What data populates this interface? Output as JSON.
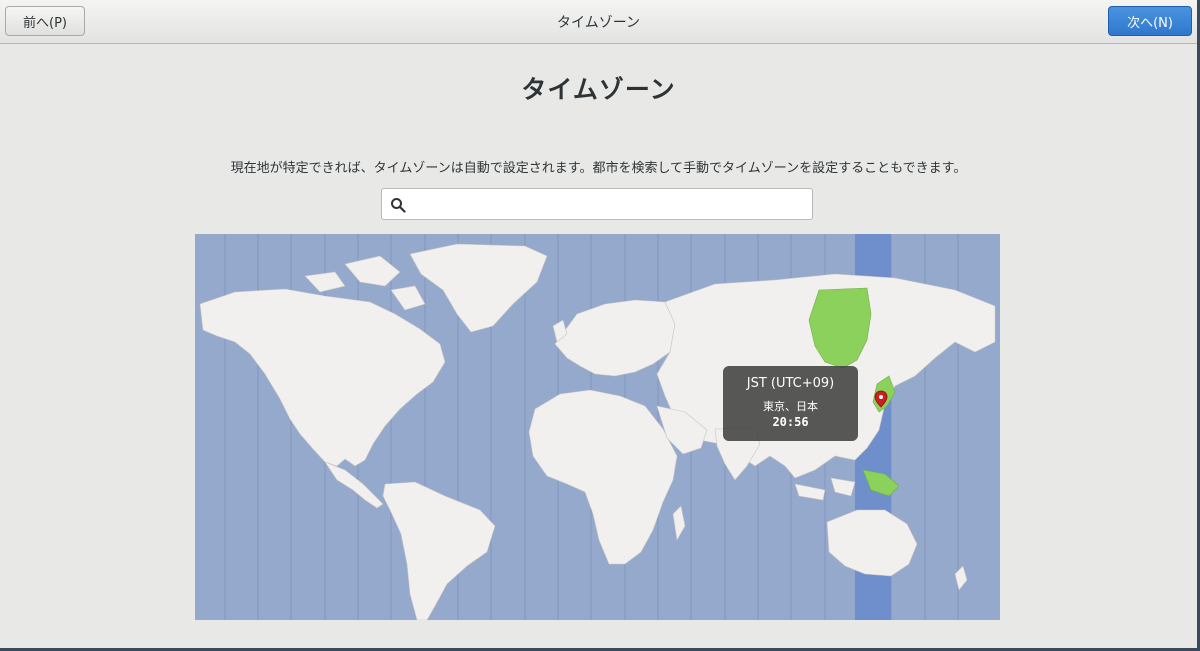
{
  "header": {
    "prev_label": "前へ(P)",
    "title": "タイムゾーン",
    "next_label": "次へ(N)"
  },
  "main": {
    "title": "タイムゾーン",
    "description": "現在地が特定できれば、タイムゾーンは自動で設定されます。都市を検索して手動でタイムゾーンを設定することもできます。",
    "search": {
      "value": "",
      "placeholder": ""
    }
  },
  "map": {
    "selected_zone_color": "#6f8fcc",
    "selected_country_color": "#8bd15b",
    "ocean_color": "#95a9cd",
    "land_color": "#f2f0ef",
    "tooltip": {
      "zone": "JST (UTC+09)",
      "city": "東京、日本",
      "time": "20:56"
    }
  },
  "icons": {
    "search": "search-icon",
    "pin": "location-pin-icon"
  }
}
